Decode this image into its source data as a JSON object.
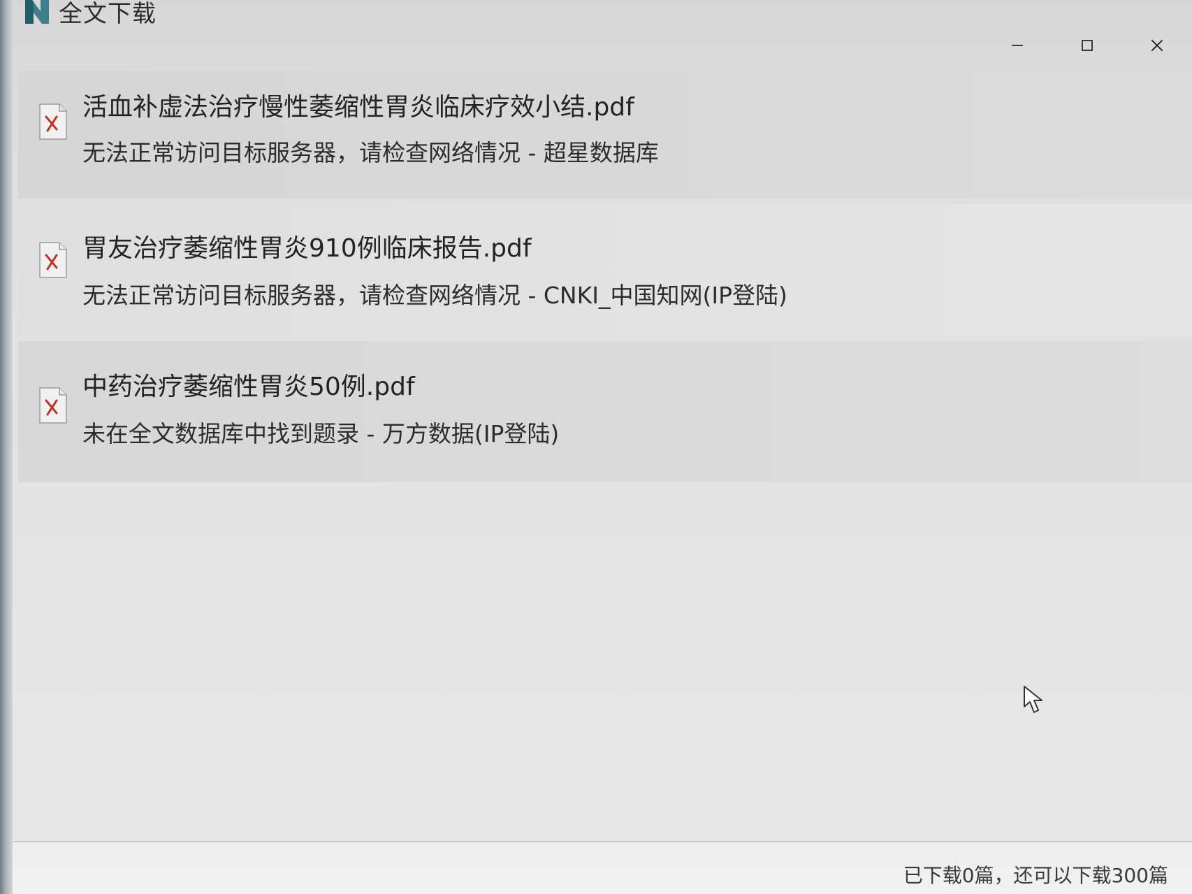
{
  "window": {
    "title": "全文下载"
  },
  "controls": {
    "minimize_icon": "minimize-icon",
    "maximize_icon": "maximize-icon",
    "close_icon": "close-icon"
  },
  "downloads": [
    {
      "file_name": "活血补虚法治疗慢性萎缩性胃炎临床疗效小结.pdf",
      "status": "无法正常访问目标服务器，请检查网络情况 - 超星数据库"
    },
    {
      "file_name": "胃友治疗萎缩性胃炎910例临床报告.pdf",
      "status": "无法正常访问目标服务器，请检查网络情况 - CNKI_中国知网(IP登陆)"
    },
    {
      "file_name": "中药治疗萎缩性胃炎50例.pdf",
      "status": "未在全文数据库中找到题录 - 万方数据(IP登陆)"
    }
  ],
  "footer": {
    "text": "已下载0篇，还可以下载300篇"
  },
  "colors": {
    "error_x": "#c0322a",
    "window_bg": "#e2e2e2"
  }
}
